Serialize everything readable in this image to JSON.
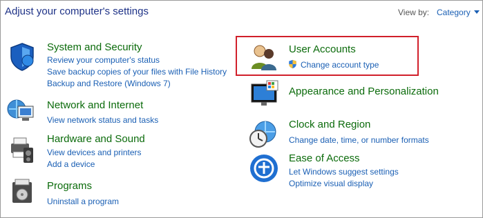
{
  "header": {
    "title": "Adjust your computer's settings",
    "view_by_label": "View by:",
    "view_by_value": "Category"
  },
  "left": [
    {
      "title": "System and Security",
      "icon": "shield-icon",
      "links": [
        "Review your computer's status",
        "Save backup copies of your files with File History",
        "Backup and Restore (Windows 7)"
      ]
    },
    {
      "title": "Network and Internet",
      "icon": "network-icon",
      "links": [
        "View network status and tasks"
      ]
    },
    {
      "title": "Hardware and Sound",
      "icon": "printer-icon",
      "links": [
        "View devices and printers",
        "Add a device"
      ]
    },
    {
      "title": "Programs",
      "icon": "programs-icon",
      "links": [
        "Uninstall a program"
      ]
    }
  ],
  "right": [
    {
      "title": "User Accounts",
      "icon": "users-icon",
      "links": [
        "Change account type"
      ],
      "highlight_color": "#d11f2a"
    },
    {
      "title": "Appearance and Personalization",
      "icon": "monitor-icon",
      "links": []
    },
    {
      "title": "Clock and Region",
      "icon": "clock-globe-icon",
      "links": [
        "Change date, time, or number formats"
      ]
    },
    {
      "title": "Ease of Access",
      "icon": "ease-of-access-icon",
      "links": [
        "Let Windows suggest settings",
        "Optimize visual display"
      ]
    }
  ]
}
